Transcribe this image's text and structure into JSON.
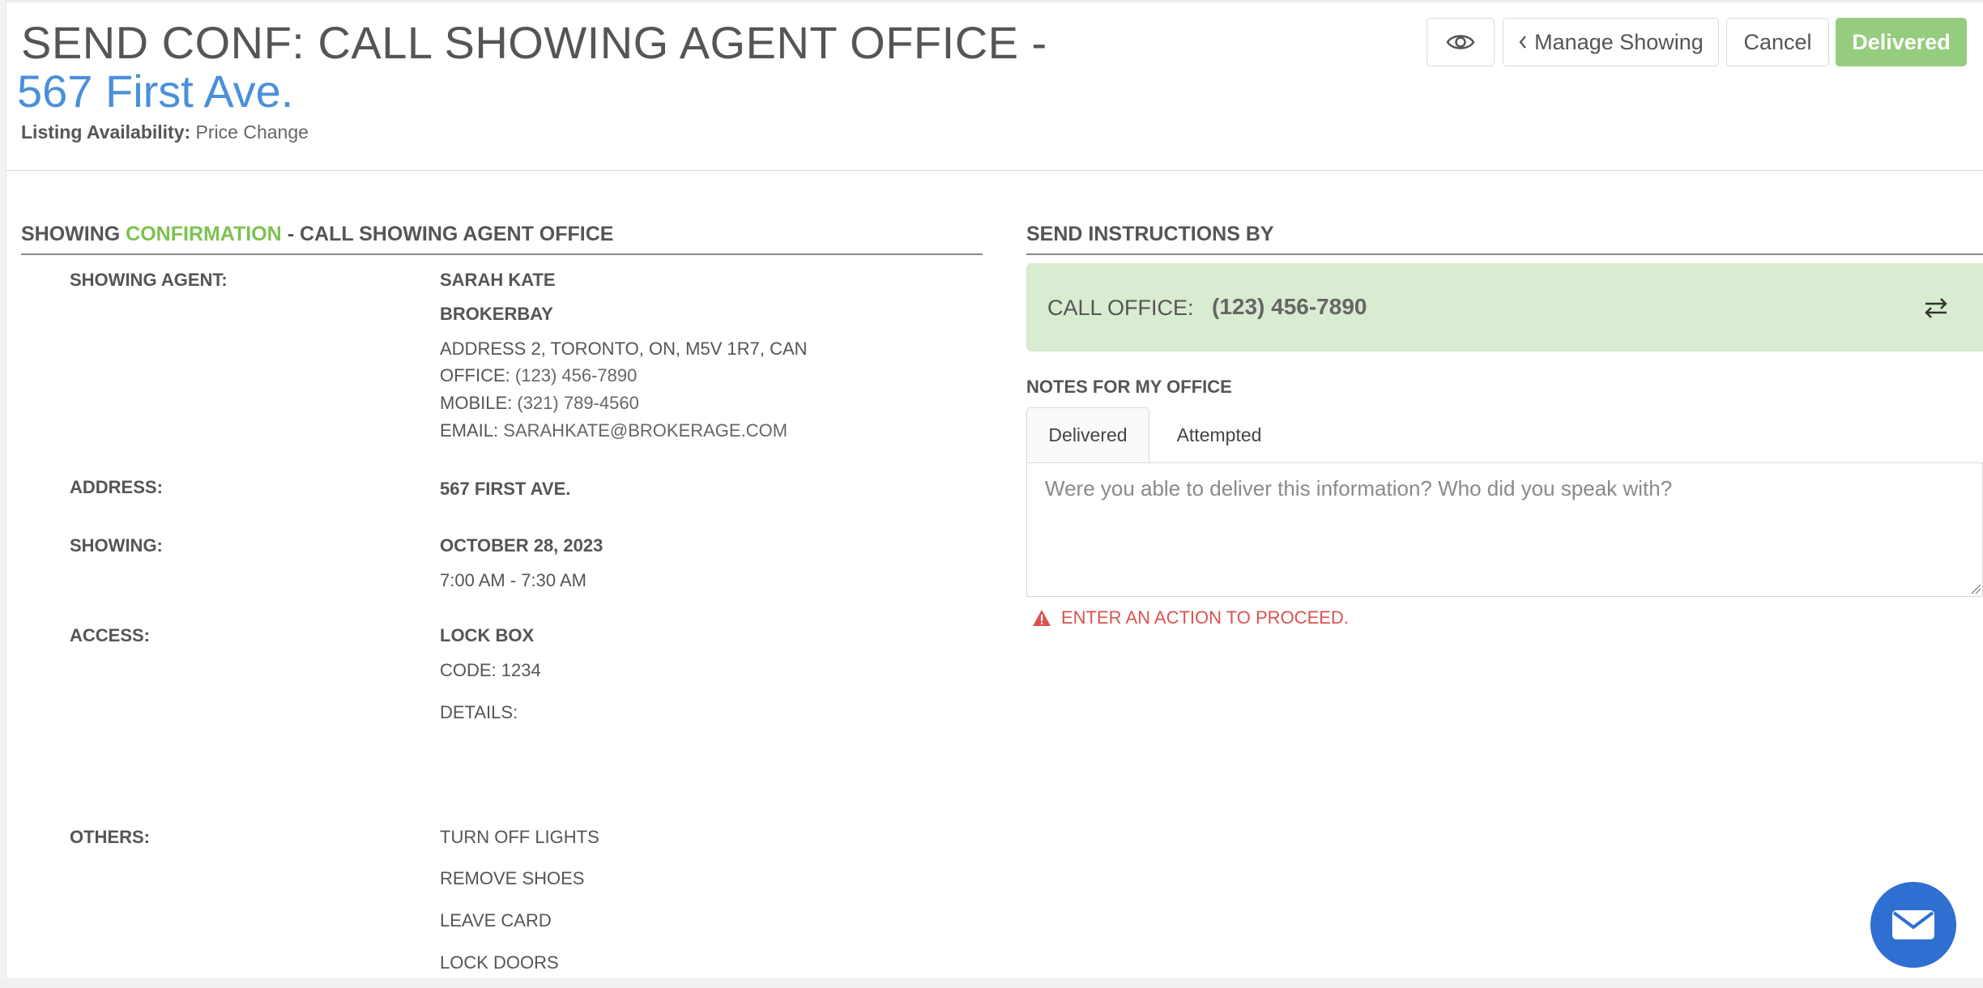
{
  "header": {
    "title": "SEND CONF: CALL SHOWING AGENT OFFICE -",
    "address": "567 First Ave.",
    "availability_label": "Listing Availability:",
    "availability_value": "Price Change"
  },
  "toolbar": {
    "preview_icon": "eye-icon",
    "manage_label": "Manage Showing",
    "cancel_label": "Cancel",
    "delivered_label": "Delivered"
  },
  "confirmation": {
    "title_prefix": "SHOWING",
    "title_highlight": "CONFIRMATION",
    "title_suffix": "- CALL SHOWING AGENT OFFICE",
    "agent_label": "SHOWING AGENT:",
    "agent_name": "SARAH KATE",
    "brokerage": "BROKERBAY",
    "agent_address": "ADDRESS 2, TORONTO, ON, M5V 1R7, CAN",
    "office_label": "OFFICE:",
    "office_phone": "(123) 456-7890",
    "mobile_label": "MOBILE:",
    "mobile_phone": "(321) 789-4560",
    "email_label": "EMAIL:",
    "email": "SARAHKATE@BROKERAGE.COM",
    "address_label": "ADDRESS:",
    "address_value": "567 FIRST AVE.",
    "showing_label": "SHOWING:",
    "showing_date": "OCTOBER 28, 2023",
    "showing_time": "7:00 AM - 7:30 AM",
    "access_label": "ACCESS:",
    "access_type": "LOCK BOX",
    "access_code": "CODE: 1234",
    "access_details": "DETAILS:",
    "others_label": "OTHERS:",
    "others": [
      "TURN OFF LIGHTS",
      "REMOVE SHOES",
      "LEAVE CARD",
      "LOCK DOORS"
    ]
  },
  "instructions": {
    "title": "SEND INSTRUCTIONS BY",
    "call_label": "CALL OFFICE:",
    "call_number": "(123) 456-7890",
    "swap_icon": "swap-arrows-icon"
  },
  "notes": {
    "title": "NOTES FOR MY OFFICE",
    "tabs": [
      "Delivered",
      "Attempted"
    ],
    "active_tab": "Delivered",
    "placeholder": "Were you able to deliver this information? Who did you speak with?",
    "value": "",
    "error_icon": "warning-icon",
    "error": "ENTER AN ACTION TO PROCEED."
  },
  "fab": {
    "icon": "mail-icon"
  },
  "colors": {
    "accent_blue": "#4a90d9",
    "confirm_green": "#7cc251",
    "delivered_button": "#95cc7d",
    "call_box": "#d9ebd0",
    "error_red": "#d9534f",
    "fab_blue": "#2f6fd2"
  }
}
